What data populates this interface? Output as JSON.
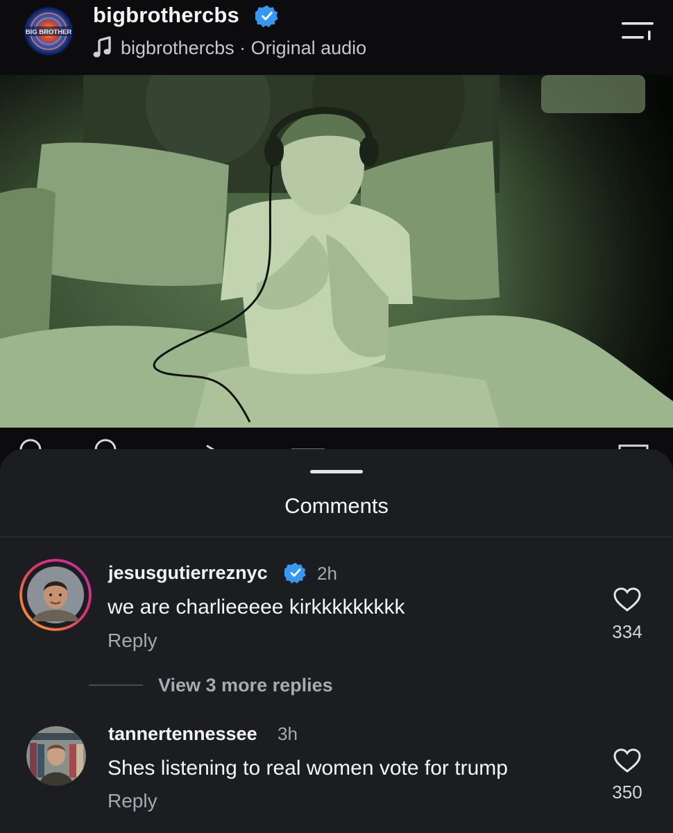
{
  "header": {
    "username": "bigbrothercbs",
    "audio": "bigbrothercbs · Original audio",
    "avatar_text": "BIG BROTHER"
  },
  "video": {
    "muted": true
  },
  "comments_sheet": {
    "title": "Comments",
    "comments": [
      {
        "username": "jesusgutierreznyc",
        "verified": true,
        "time": "2h",
        "text": "we are charlieeeee kirkkkkkkkkk",
        "reply_label": "Reply",
        "likes": "334",
        "view_replies": "View 3 more replies"
      },
      {
        "username": "tannertennessee",
        "verified": false,
        "time": "3h",
        "text": "Shes listening to real women vote for trump",
        "reply_label": "Reply",
        "likes": "350"
      }
    ]
  },
  "colors": {
    "background": "#0c0c0e",
    "sheet": "#1c1d21",
    "verified_blue": "#3897f0",
    "story_ring_start": "#f9a72b",
    "story_ring_end": "#c12fb0",
    "night_vision_green": "#4f6a45"
  }
}
